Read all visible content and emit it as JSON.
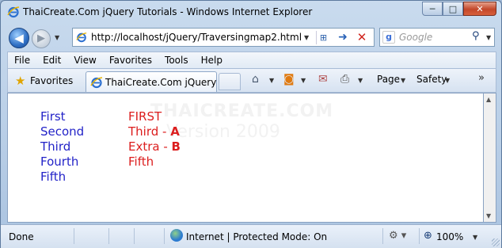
{
  "window": {
    "title": "ThaiCreate.Com jQuery Tutorials - Windows Internet Explorer",
    "buttons": {
      "minimize": "─",
      "maximize": "□",
      "close": "✕"
    }
  },
  "nav": {
    "back_glyph": "◀",
    "forward_glyph": "▶",
    "address": "http://localhost/jQuery/Traversingmap2.html",
    "search_placeholder": "Google",
    "search_engine_glyph": "g"
  },
  "menu": [
    "File",
    "Edit",
    "View",
    "Favorites",
    "Tools",
    "Help"
  ],
  "favorites_bar": {
    "favorites_label": "Favorites",
    "tab_title": "ThaiCreate.Com jQuery ...",
    "commands": {
      "page": "Page",
      "safety": "Safety"
    }
  },
  "content": {
    "watermark_line1": "THAICREATE.COM",
    "watermark_line2": "Version 2009",
    "left_list": [
      "First",
      "Second",
      "Third",
      "Fourth",
      "Fifth"
    ],
    "right_list": [
      {
        "text": "FIRST",
        "suffix": ""
      },
      {
        "text": "Third - ",
        "suffix": "A"
      },
      {
        "text": "Extra - ",
        "suffix": "B"
      },
      {
        "text": "Fifth",
        "suffix": ""
      }
    ],
    "colors": {
      "left": "#2323c8",
      "right": "#dc1e1e"
    }
  },
  "status": {
    "text": "Done",
    "zone": "Internet | Protected Mode: On",
    "zoom": "100%"
  },
  "icons": {
    "ie": "ie-logo-icon",
    "favorites": "star-icon",
    "home": "home-icon",
    "feeds": "rss-icon",
    "mail": "mail-icon",
    "print": "printer-icon",
    "refresh": "refresh-icon",
    "stop": "stop-icon",
    "search": "magnifier-icon",
    "globe": "globe-icon",
    "zoom": "zoom-icon"
  }
}
